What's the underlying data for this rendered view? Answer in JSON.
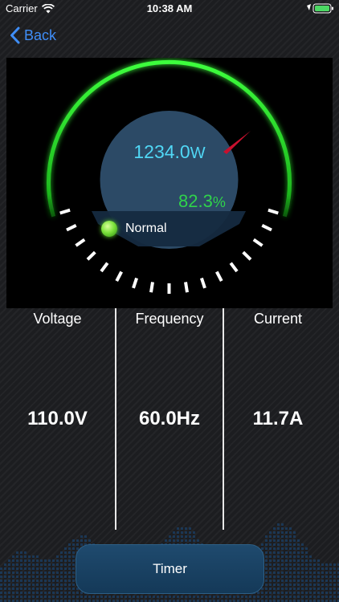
{
  "status_bar": {
    "carrier": "Carrier",
    "time": "10:38 AM",
    "icons": [
      "wifi-icon",
      "location-icon",
      "battery-icon"
    ]
  },
  "nav": {
    "back_label": "Back",
    "icon": "chevron-left-icon"
  },
  "gauge": {
    "power_value": "1234.0",
    "power_unit": "W",
    "efficiency_value": "82.3",
    "efficiency_unit": "%",
    "status": "Normal",
    "colors": {
      "arc": "#33ff33",
      "needle": "#c8102e",
      "power_text": "#50d7f5",
      "efficiency_text": "#2fd34b",
      "dial": "#2c4a66"
    }
  },
  "metrics": [
    {
      "title": "Voltage",
      "value": "110.0V"
    },
    {
      "title": "Frequency",
      "value": "60.0Hz"
    },
    {
      "title": "Current",
      "value": "11.7A"
    }
  ],
  "timer_button": {
    "label": "Timer"
  },
  "colors": {
    "accent": "#3f8ef8",
    "button_bg": "#1f4a6e"
  }
}
